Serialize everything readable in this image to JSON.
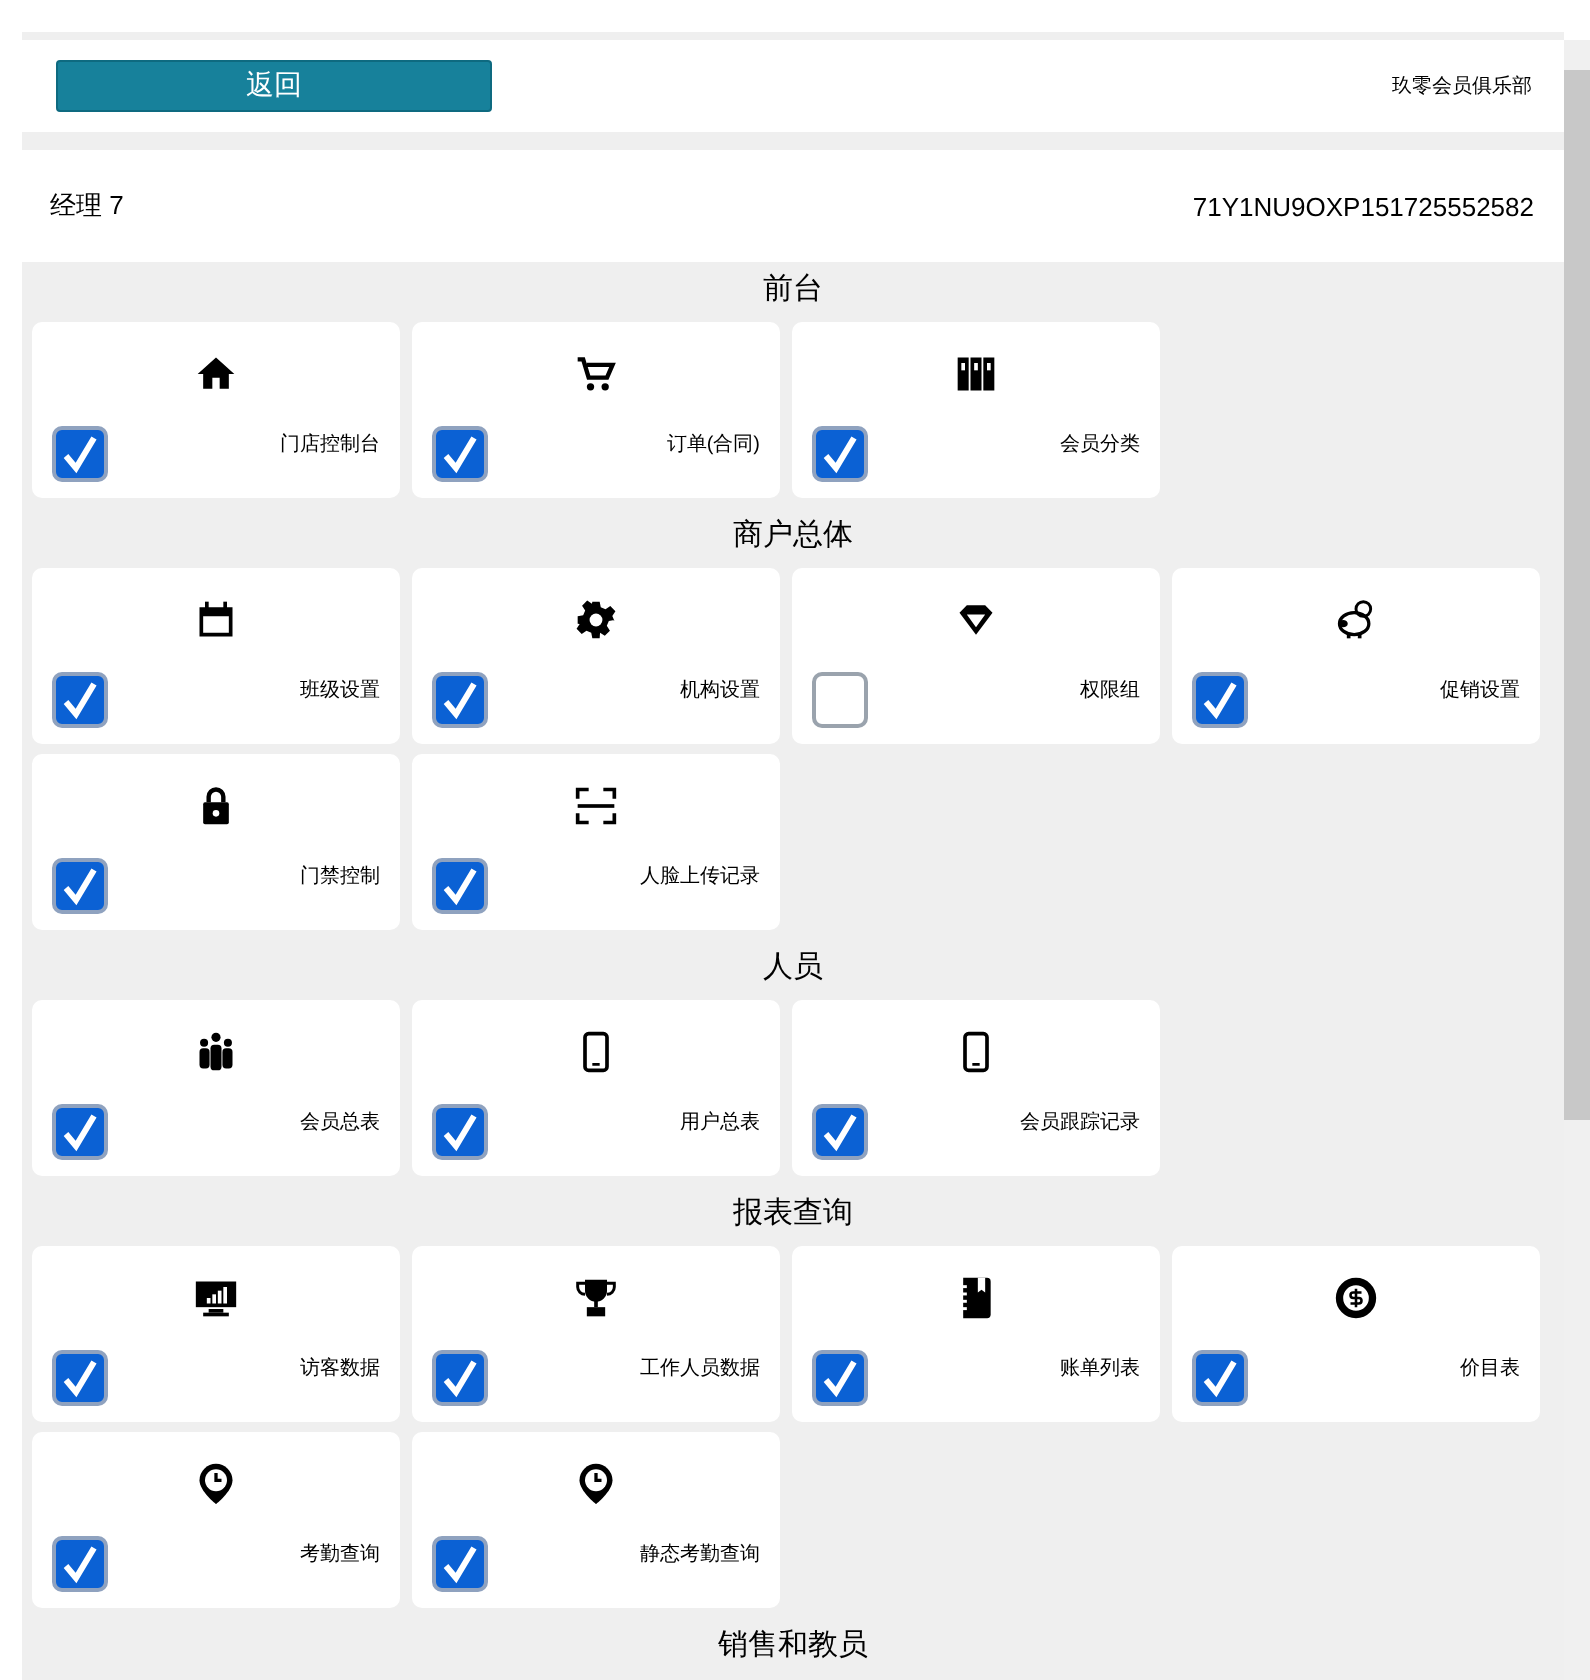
{
  "header": {
    "back_button": "返回",
    "club_name": "玖零会员俱乐部"
  },
  "user": {
    "name": "经理 7",
    "code": "71Y1NU9OXP151725552582"
  },
  "sections": [
    {
      "title": "前台",
      "items": [
        {
          "label": "门店控制台",
          "checked": true
        },
        {
          "label": "订单(合同)",
          "checked": true
        },
        {
          "label": "会员分类",
          "checked": true
        }
      ]
    },
    {
      "title": "商户总体",
      "items": [
        {
          "label": "班级设置",
          "checked": true
        },
        {
          "label": "机构设置",
          "checked": true
        },
        {
          "label": "权限组",
          "checked": false
        },
        {
          "label": "促销设置",
          "checked": true
        },
        {
          "label": "门禁控制",
          "checked": true
        },
        {
          "label": "人脸上传记录",
          "checked": true
        }
      ]
    },
    {
      "title": "人员",
      "items": [
        {
          "label": "会员总表",
          "checked": true
        },
        {
          "label": "用户总表",
          "checked": true
        },
        {
          "label": "会员跟踪记录",
          "checked": true
        }
      ]
    },
    {
      "title": "报表查询",
      "items": [
        {
          "label": "访客数据",
          "checked": true
        },
        {
          "label": "工作人员数据",
          "checked": true
        },
        {
          "label": "账单列表",
          "checked": true
        },
        {
          "label": "价目表",
          "checked": true
        },
        {
          "label": "考勤查询",
          "checked": true
        },
        {
          "label": "静态考勤查询",
          "checked": true
        }
      ]
    },
    {
      "title": "销售和教员"
    }
  ]
}
